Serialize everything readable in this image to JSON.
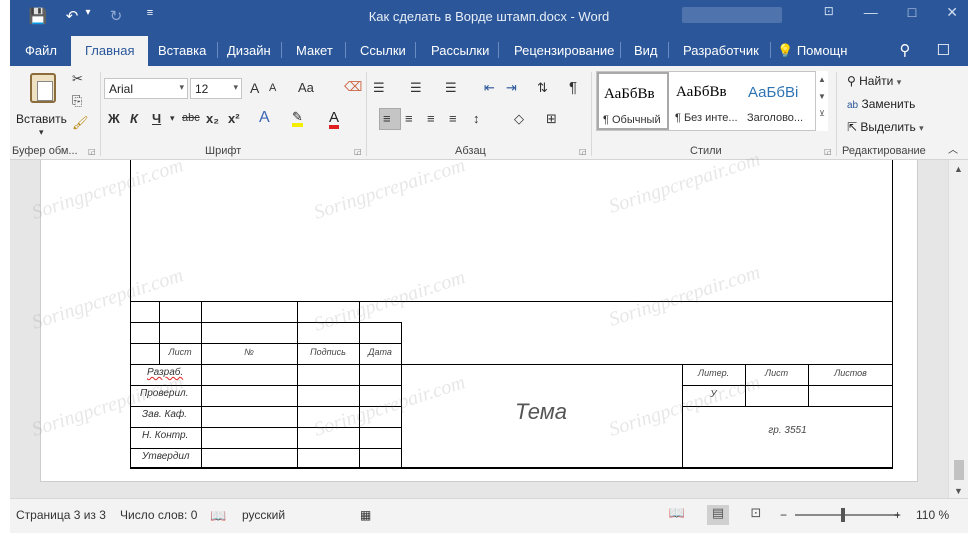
{
  "window": {
    "title": "Как сделать в Ворде штамп.docx - Word",
    "controls": [
      "—",
      "□",
      "✕"
    ]
  },
  "quick_access": {
    "save_icon": "💾",
    "undo_icon": "↶",
    "undo_dropdown": "▾",
    "redo_icon": "↻",
    "customize_icon": "≡"
  },
  "tabs": [
    {
      "label": "Файл"
    },
    {
      "label": "Главная"
    },
    {
      "label": "Вставка"
    },
    {
      "label": "Дизайн"
    },
    {
      "label": "Макет"
    },
    {
      "label": "Ссылки"
    },
    {
      "label": "Рассылки"
    },
    {
      "label": "Рецензирование"
    },
    {
      "label": "Вид"
    },
    {
      "label": "Разработчик"
    },
    {
      "label": "Помощн"
    }
  ],
  "ribbon": {
    "clipboard": {
      "label": "Буфер обм...",
      "paste_label": "Вставить",
      "paste_arrow": "▾"
    },
    "font": {
      "label": "Шрифт",
      "font_name": "Arial",
      "font_size": "12",
      "bold": "Ж",
      "italic": "К",
      "underline": "Ч",
      "strike": "abc",
      "subscript": "x₂",
      "superscript": "x²",
      "grow": "A",
      "shrink": "A",
      "case": "Aa",
      "effects": "A",
      "color": "A"
    },
    "paragraph": {
      "label": "Абзац",
      "pilcrow": "¶"
    },
    "styles": {
      "label": "Стили",
      "items": [
        {
          "sample": "АаБбВв",
          "name": "¶ Обычный"
        },
        {
          "sample": "АаБбВв",
          "name": "¶ Без инте..."
        },
        {
          "sample": "АаБбВі",
          "name": "Заголово..."
        }
      ]
    },
    "editing": {
      "label": "Редактирование",
      "find": "Найти",
      "replace": "Заменить",
      "select": "Выделить"
    },
    "collapse_icon": "︿"
  },
  "stamp": {
    "header_row": [
      "Лист",
      "№",
      "Подпись",
      "Дата"
    ],
    "roles": [
      "Разраб.",
      "Проверил.",
      "Зав. Каф.",
      "Н. Контр.",
      "Утвердил"
    ],
    "right_headers": [
      "Литер.",
      "Лист",
      "Листов"
    ],
    "liter_value": "У",
    "topic": "Тема",
    "group": "гр. 3551"
  },
  "watermark_text": "Soringpcrepair.com",
  "statusbar": {
    "page": "Страница 3 из 3",
    "words": "Число слов: 0",
    "language": "русский",
    "zoom": "110 %",
    "minus": "−",
    "plus": "+"
  },
  "colors": {
    "accent": "#2b579a",
    "ribbon_bg": "#f3f3f3",
    "workspace_bg": "#e6e6e6"
  }
}
